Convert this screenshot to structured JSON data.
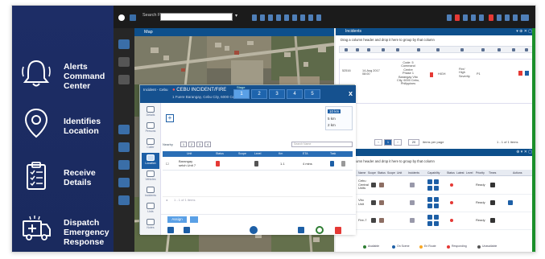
{
  "promo": {
    "items": [
      {
        "label": "Alerts\nCommand\nCenter",
        "icon": "bell-icon"
      },
      {
        "label": "Identifies\nLocation",
        "icon": "location-pin-icon"
      },
      {
        "label": "Receive\nDetails",
        "icon": "clipboard-icon"
      },
      {
        "label": "Dispatch\nEmergency\nResponse",
        "icon": "ambulance-icon"
      }
    ]
  },
  "topbar": {
    "search_label": "Search For"
  },
  "map": {
    "title": "Map"
  },
  "incidents": {
    "title": "Incidents",
    "subtitle": "Drag a column header and drop it here to group by that column",
    "row": {
      "id": "52516",
      "date": "14-Aug 2017 08:00",
      "details": "Code: 5\nCommand\nCentre\nPhase 1\nBarangay Vito\nCity, 6000 Cebu,\nPhilippines",
      "priority": "HIGH",
      "status": "Fire/\nHigh\nSeverity",
      "right_code": "P1"
    },
    "pager": {
      "page": "1",
      "per_page": "20",
      "per_page_label": "items per page",
      "summary": "1 - 1 of 1 items"
    }
  },
  "units": {
    "subtitle": "Drag a column header and drop it here to group by that column",
    "columns": [
      "Location",
      "Name",
      "Scope",
      "Status",
      "Scope",
      "Unit",
      "Incidents",
      "Capability",
      "Status",
      "Latest",
      "Level",
      "Priority",
      "Times",
      "Actions"
    ],
    "rows": [
      {
        "location": "Cebu\nBarangay",
        "name": "Cebu\nCentral\nUnits",
        "capability": "Ready"
      },
      {
        "location": "Barangay\nsetch.seen",
        "name": "Vito\nUnit",
        "capability": "Ready"
      },
      {
        "location": "Fire/unit 4",
        "name": "Fire-7",
        "capability": "Ready"
      }
    ],
    "legend": [
      "Available",
      "On Scene",
      "En Route",
      "Responding",
      "Unavailable"
    ]
  },
  "dialog": {
    "header_small": "Incident - Cebu",
    "title": "CEBU INCIDENT/FIRE",
    "address": "1 Fuere Barangay, Cebu City, 6000 Cebu",
    "stage_label": "Stage",
    "stages": [
      "1",
      "2",
      "3",
      "4",
      "5"
    ],
    "side_items": [
      "Details",
      "Persons",
      "Caller",
      "Location",
      "Vehicles",
      "Incidents",
      "Lists",
      "Notes"
    ],
    "zoom_options": [
      "10 km",
      "5 km",
      "2 km"
    ],
    "filter_label": "Nearby",
    "filter_buttons": [
      "1",
      "2",
      "3",
      "4"
    ],
    "search_placeholder": "Search Name",
    "results_headers": [
      "Unit",
      "Status",
      "Scope",
      "Level",
      "Km",
      "ETA",
      "Task"
    ],
    "result_row": {
      "unit": "Barangay\nsetch Unit 7",
      "km": "1.1",
      "eta": "4 mins"
    },
    "pager_text": "1 - 1 of 1 items",
    "assign_label": "Assign",
    "close_label": "x"
  },
  "colors": {
    "promo_bg": "#1d2d66",
    "header_blue": "#0d4f8b",
    "accent_green": "#1b8f2a",
    "alert_red": "#e53935"
  }
}
